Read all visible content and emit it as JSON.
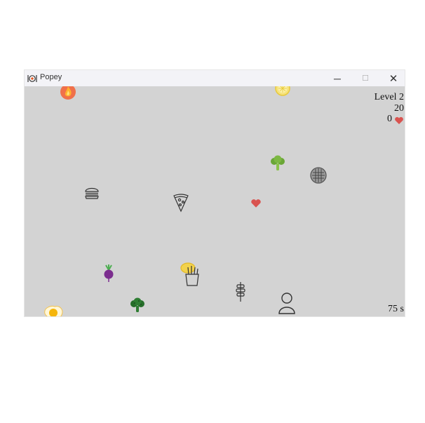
{
  "window": {
    "title": "Popey",
    "minimize_glyph": "─",
    "maximize_glyph": "☐",
    "close_glyph": "✕",
    "icon": "plate-utensils-icon"
  },
  "hud": {
    "level": "Level 2",
    "score": "20",
    "lives": "0",
    "lives_icon": "heart-icon",
    "timer": "75 s"
  },
  "game_objects": [
    "fire-icon",
    "lemon-slice-icon",
    "broccoli-icon",
    "waffle-icon",
    "burger-icon",
    "pizza-slice-icon",
    "heart-pickup-icon",
    "beet-icon",
    "fries-icon",
    "kebab-icon",
    "broccoli-dark-icon",
    "player-icon",
    "fried-egg-icon"
  ],
  "colors": {
    "canvas_bg": "#d3d3d3",
    "titlebar_bg": "#f3f3f7",
    "heart": "#d9534f",
    "broccoli": "#6aa636",
    "broccoli_dark": "#2e7d32",
    "beet": "#7b2d8e"
  }
}
